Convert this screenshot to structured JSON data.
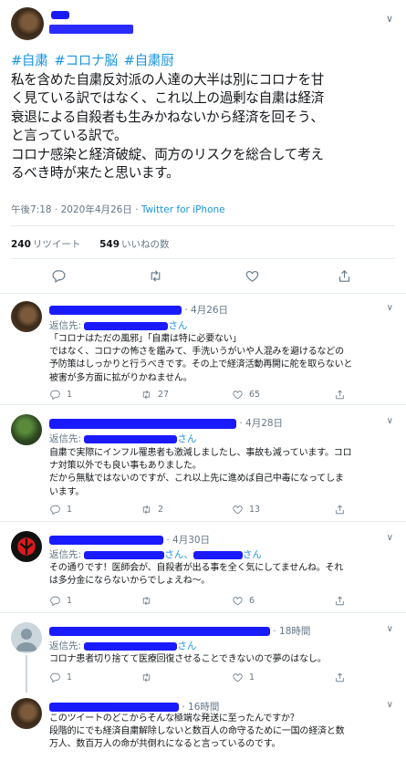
{
  "main_tweet": {
    "hashtags": [
      "#自粛",
      "#コロナ脳",
      "#自粛厨"
    ],
    "lines": [
      "私を含めた自粛反対派の人達の大半は別にコロナを甘",
      "く見ている訳ではなく、これ以上の過剰な自粛は経済",
      "衰退による自殺者も生みかねないから経済を回そう、",
      "と言っている訳で。",
      "コロナ感染と経済破綻、両方のリスクを総合して考え",
      "るべき時が来たと思います。"
    ],
    "timestamp": "午後7:18 · 2020年4月26日 · ",
    "source": "Twitter for iPhone",
    "retweets_count": "240",
    "retweets_label": "リツイート",
    "likes_count": "549",
    "likes_label": "いいねの数"
  },
  "replies": [
    {
      "time": "· 4月26日",
      "reply_prefix": "返信先:",
      "reply_suffix": "さん",
      "lines": [
        "「コロナはただの風邪」「自粛は特に必要ない」",
        "ではなく、コロナの怖さを鑑みて、手洗いうがいや人混みを避けるなどの",
        "予防策はしっかりと行うべきです。その上で経済活動再開に舵を取らないと",
        "被害が多方面に拡がりかねません。"
      ],
      "reply_count": "1",
      "retweet_count": "27",
      "like_count": "65"
    },
    {
      "time": "· 4月28日",
      "reply_prefix": "返信先:",
      "reply_suffix": "さん",
      "lines": [
        "自粛で実際にインフル罹患者も激減しましたし、事故も減っています。コロ",
        "ナ対策以外でも良い事もありました。",
        "だから無駄ではないのですが、これ以上先に進めば自己中毒になってしま",
        "います。"
      ],
      "reply_count": "1",
      "retweet_count": "2",
      "like_count": "13"
    },
    {
      "time": "· 4月30日",
      "reply_prefix": "返信先:",
      "reply_mid": "さん、",
      "reply_suffix": "さん",
      "lines": [
        "その通りです！医師会が、自殺者が出る事を全く気にしてませんね。それ",
        "は多分金にならないからでしょえね〜。"
      ],
      "reply_count": "1",
      "retweet_count": "",
      "like_count": "6"
    },
    {
      "time": "· 18時間",
      "reply_prefix": "返信先:",
      "reply_suffix": "さん",
      "lines": [
        "コロナ患者切り捨てて医療回復させることできないので夢のはなし。"
      ],
      "reply_count": "1",
      "retweet_count": "",
      "like_count": "1"
    },
    {
      "time": "· 16時間",
      "lines": [
        "このツイートのどこからそんな極端な発送に至ったんですか？",
        "段階的にでも経済自粛解除しないと数百人の命守るために一国の経済と数",
        "万人、数百万人の命が共倒れになると言っているのです。"
      ]
    }
  ],
  "icons": [
    "reply-icon",
    "retweet-icon",
    "like-icon",
    "share-icon",
    "chevron-down-icon"
  ],
  "colors": {
    "link": "#1b95e0",
    "muted": "#657786",
    "redaction": "#1a1aff"
  }
}
